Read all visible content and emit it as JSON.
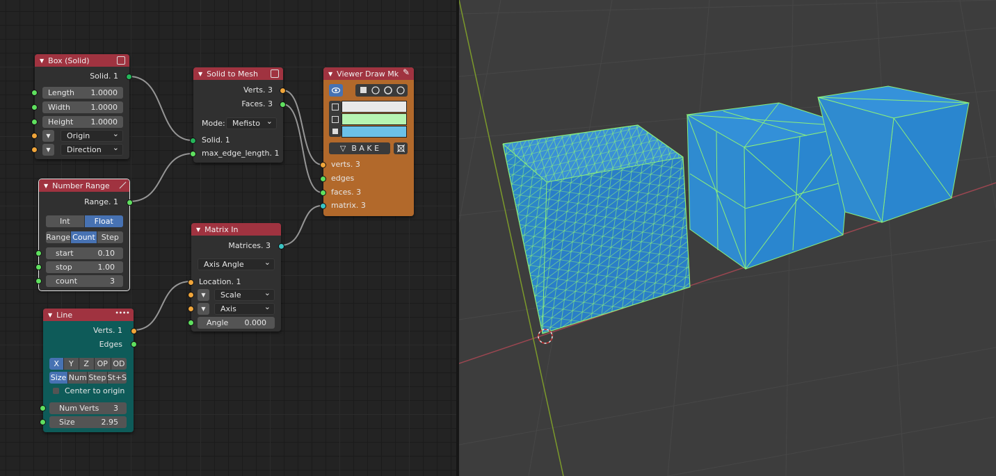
{
  "nodes": {
    "box": {
      "title": "Box (Solid)",
      "out": "Solid. 1",
      "length_label": "Length",
      "length_val": "1.0000",
      "width_label": "Width",
      "width_val": "1.0000",
      "height_label": "Height",
      "height_val": "1.0000",
      "origin": "Origin",
      "direction": "Direction"
    },
    "range": {
      "title": "Number Range",
      "out": "Range. 1",
      "mode_int": "Int",
      "mode_float": "Float",
      "m_range": "Range",
      "m_count": "Count",
      "m_step": "Step",
      "start_label": "start",
      "start_val": "0.10",
      "stop_label": "stop",
      "stop_val": "1.00",
      "count_label": "count",
      "count_val": "3"
    },
    "line": {
      "title": "Line",
      "out_verts": "Verts. 1",
      "out_edges": "Edges",
      "ax_x": "X",
      "ax_y": "Y",
      "ax_z": "Z",
      "ax_op": "OP",
      "ax_od": "OD",
      "sz_size": "Size",
      "sz_num": "Num",
      "sz_step": "Step",
      "sz_sts": "St+S",
      "center": "Center to origin",
      "numverts_label": "Num Verts",
      "numverts_val": "3",
      "size_label": "Size",
      "size_val": "2.95"
    },
    "s2m": {
      "title": "Solid to Mesh",
      "out_verts": "Verts. 3",
      "out_faces": "Faces. 3",
      "mode_label": "Mode:",
      "mode_val": "Mefisto",
      "in_solid": "Solid. 1",
      "in_edge": "max_edge_length. 1"
    },
    "matrix": {
      "title": "Matrix In",
      "out": "Matrices. 3",
      "mode": "Axis Angle",
      "location": "Location. 1",
      "scale": "Scale",
      "axis": "Axis",
      "angle_label": "Angle",
      "angle_val": "0.000"
    },
    "viewer": {
      "title": "Viewer Draw Mk",
      "bake": "B A K E",
      "in_verts": "verts. 3",
      "in_edges": "edges",
      "in_faces": "faces. 3",
      "in_matrix": "matrix. 3",
      "color_verts": "#e9e9e9",
      "color_edges": "#b6f4b2",
      "color_faces": "#6cc1e8"
    }
  },
  "colors": {
    "node_header": "#a03340",
    "viewer_body": "#b2692b",
    "line_body": "#0e5b59",
    "mesh_face": "#2a8ad4",
    "mesh_edge": "#8cf07a",
    "accent_blue": "#4772b3"
  }
}
